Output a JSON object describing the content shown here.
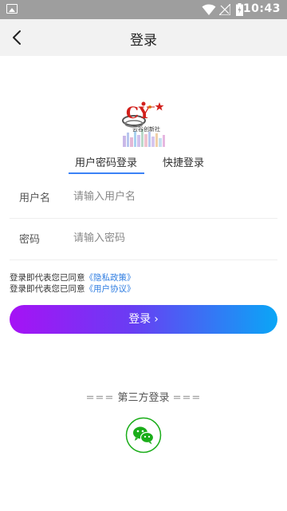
{
  "status": {
    "time": "10:43"
  },
  "header": {
    "title": "登录"
  },
  "logo": {
    "brand_text": "云谷创新社",
    "mark": "CY"
  },
  "tabs": [
    {
      "label": "用户密码登录",
      "active": true
    },
    {
      "label": "快捷登录",
      "active": false
    }
  ],
  "form": {
    "username": {
      "label": "用户名",
      "placeholder": "请输入用户名",
      "value": ""
    },
    "password": {
      "label": "密码",
      "placeholder": "请输入密码",
      "value": ""
    }
  },
  "agreement": {
    "prefix": "登录即代表您已同意",
    "privacy_link": "《隐私政策》",
    "terms_link": "《用户协议》"
  },
  "login_button": {
    "label": "登录",
    "arrow": "›"
  },
  "third_party": {
    "title": "第三方登录",
    "deco_left": "===",
    "deco_right": "===",
    "icon": "wechat-icon"
  },
  "colors": {
    "accent_blue": "#3b82f6",
    "link": "#2f7de1",
    "button_start": "#a612f5",
    "button_end": "#0aa6f6",
    "wechat_green": "#1aad19"
  }
}
